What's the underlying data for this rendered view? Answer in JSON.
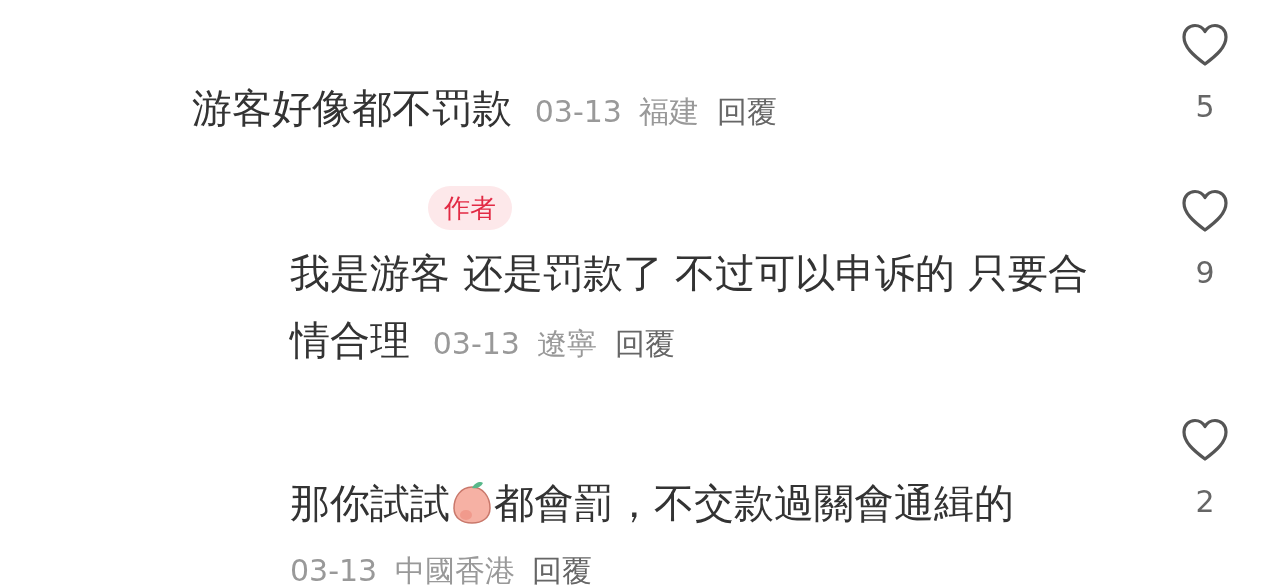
{
  "comments": [
    {
      "segments": [
        {
          "kind": "text",
          "text": "游客好像都不罚款"
        }
      ],
      "date": "03-13",
      "location": "福建",
      "reply_label": "回覆",
      "likes": "5",
      "liked": false,
      "children": [
        {
          "author_badge": "作者",
          "segments": [
            {
              "kind": "text",
              "text": "我是游客 还是罚款了 不过可以申诉的 只要合"
            },
            {
              "kind": "break"
            },
            {
              "kind": "text",
              "text": "情合理"
            }
          ],
          "date": "03-13",
          "location": "遼寧",
          "reply_label": "回覆",
          "likes": "9",
          "liked": false
        },
        {
          "segments": [
            {
              "kind": "text",
              "text": "那你試試"
            },
            {
              "kind": "sticker"
            },
            {
              "kind": "text",
              "text": "都會罰，不交款過關會通緝的"
            }
          ],
          "date": "03-13",
          "location": "中國香港",
          "reply_label": "回覆",
          "likes": "2",
          "liked": false,
          "meta_below": true
        }
      ]
    }
  ]
}
